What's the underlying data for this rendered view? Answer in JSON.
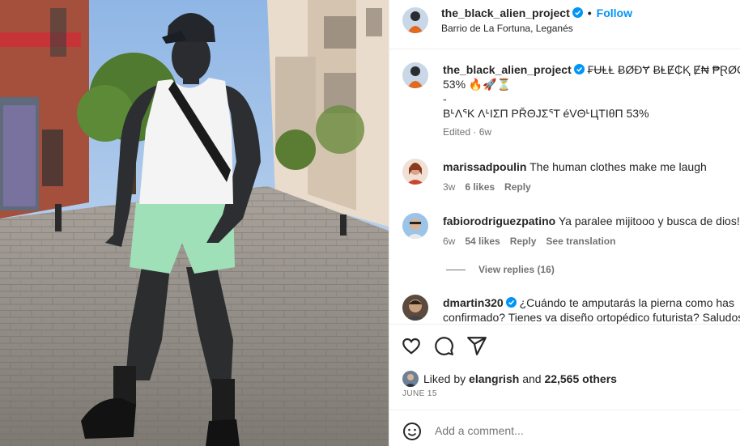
{
  "post": {
    "username": "the_black_alien_project",
    "follow_label": "Follow",
    "location": "Barrio de La Fortuna, Leganés",
    "caption": {
      "line1": "₣ɄⱠⱠ ɃØĐɎ ɃⱠɆ₵Ⱪ Ɇ₦ ₱ⱤØ₲ⱤɆ",
      "line2": "53% 🔥🚀⏳",
      "line3": "-",
      "line4": "BᒻΛᕐK ΛᒻΙΣΠ PŘΘJΣᕐT éVΘᒻЦTIθΠ 53%",
      "edited": "Edited · 6w"
    }
  },
  "comments": [
    {
      "username": "marissadpoulin",
      "text": "The human clothes make me laugh",
      "time": "3w",
      "likes": "6 likes",
      "reply": "Reply"
    },
    {
      "username": "fabiorodriguezpatino",
      "text": "Ya paralee mijitooo y busca de dios!!!",
      "time": "6w",
      "likes": "54 likes",
      "reply": "Reply",
      "translate": "See translation",
      "view_replies": "View replies (16)"
    },
    {
      "username": "dmartin320",
      "text": "¿Cuándo te amputarás la pierna como has",
      "text2": "confirmado? Tienes va diseño ortopédico futurista? Saludos"
    }
  ],
  "likes": {
    "prefix": "Liked by",
    "user": "elangrish",
    "and": "and",
    "others": "22,565 others"
  },
  "date": "JUNE 15",
  "add_comment": {
    "placeholder": "Add a comment..."
  },
  "icons": [
    "heart-icon",
    "comment-icon",
    "share-icon",
    "emoji-icon",
    "verified-icon"
  ],
  "colors": {
    "link": "#0095f6",
    "verified": "#0095f6",
    "muted": "#737373",
    "border": "#efefef"
  }
}
